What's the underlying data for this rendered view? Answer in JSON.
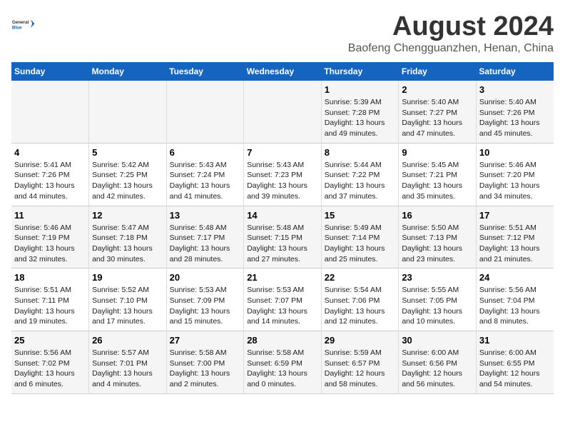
{
  "header": {
    "logo_line1": "General",
    "logo_line2": "Blue",
    "month_year": "August 2024",
    "location": "Baofeng Chengguanzhen, Henan, China"
  },
  "days_of_week": [
    "Sunday",
    "Monday",
    "Tuesday",
    "Wednesday",
    "Thursday",
    "Friday",
    "Saturday"
  ],
  "weeks": [
    [
      {
        "day": "",
        "info": ""
      },
      {
        "day": "",
        "info": ""
      },
      {
        "day": "",
        "info": ""
      },
      {
        "day": "",
        "info": ""
      },
      {
        "day": "1",
        "info": "Sunrise: 5:39 AM\nSunset: 7:28 PM\nDaylight: 13 hours\nand 49 minutes."
      },
      {
        "day": "2",
        "info": "Sunrise: 5:40 AM\nSunset: 7:27 PM\nDaylight: 13 hours\nand 47 minutes."
      },
      {
        "day": "3",
        "info": "Sunrise: 5:40 AM\nSunset: 7:26 PM\nDaylight: 13 hours\nand 45 minutes."
      }
    ],
    [
      {
        "day": "4",
        "info": "Sunrise: 5:41 AM\nSunset: 7:26 PM\nDaylight: 13 hours\nand 44 minutes."
      },
      {
        "day": "5",
        "info": "Sunrise: 5:42 AM\nSunset: 7:25 PM\nDaylight: 13 hours\nand 42 minutes."
      },
      {
        "day": "6",
        "info": "Sunrise: 5:43 AM\nSunset: 7:24 PM\nDaylight: 13 hours\nand 41 minutes."
      },
      {
        "day": "7",
        "info": "Sunrise: 5:43 AM\nSunset: 7:23 PM\nDaylight: 13 hours\nand 39 minutes."
      },
      {
        "day": "8",
        "info": "Sunrise: 5:44 AM\nSunset: 7:22 PM\nDaylight: 13 hours\nand 37 minutes."
      },
      {
        "day": "9",
        "info": "Sunrise: 5:45 AM\nSunset: 7:21 PM\nDaylight: 13 hours\nand 35 minutes."
      },
      {
        "day": "10",
        "info": "Sunrise: 5:46 AM\nSunset: 7:20 PM\nDaylight: 13 hours\nand 34 minutes."
      }
    ],
    [
      {
        "day": "11",
        "info": "Sunrise: 5:46 AM\nSunset: 7:19 PM\nDaylight: 13 hours\nand 32 minutes."
      },
      {
        "day": "12",
        "info": "Sunrise: 5:47 AM\nSunset: 7:18 PM\nDaylight: 13 hours\nand 30 minutes."
      },
      {
        "day": "13",
        "info": "Sunrise: 5:48 AM\nSunset: 7:17 PM\nDaylight: 13 hours\nand 28 minutes."
      },
      {
        "day": "14",
        "info": "Sunrise: 5:48 AM\nSunset: 7:15 PM\nDaylight: 13 hours\nand 27 minutes."
      },
      {
        "day": "15",
        "info": "Sunrise: 5:49 AM\nSunset: 7:14 PM\nDaylight: 13 hours\nand 25 minutes."
      },
      {
        "day": "16",
        "info": "Sunrise: 5:50 AM\nSunset: 7:13 PM\nDaylight: 13 hours\nand 23 minutes."
      },
      {
        "day": "17",
        "info": "Sunrise: 5:51 AM\nSunset: 7:12 PM\nDaylight: 13 hours\nand 21 minutes."
      }
    ],
    [
      {
        "day": "18",
        "info": "Sunrise: 5:51 AM\nSunset: 7:11 PM\nDaylight: 13 hours\nand 19 minutes."
      },
      {
        "day": "19",
        "info": "Sunrise: 5:52 AM\nSunset: 7:10 PM\nDaylight: 13 hours\nand 17 minutes."
      },
      {
        "day": "20",
        "info": "Sunrise: 5:53 AM\nSunset: 7:09 PM\nDaylight: 13 hours\nand 15 minutes."
      },
      {
        "day": "21",
        "info": "Sunrise: 5:53 AM\nSunset: 7:07 PM\nDaylight: 13 hours\nand 14 minutes."
      },
      {
        "day": "22",
        "info": "Sunrise: 5:54 AM\nSunset: 7:06 PM\nDaylight: 13 hours\nand 12 minutes."
      },
      {
        "day": "23",
        "info": "Sunrise: 5:55 AM\nSunset: 7:05 PM\nDaylight: 13 hours\nand 10 minutes."
      },
      {
        "day": "24",
        "info": "Sunrise: 5:56 AM\nSunset: 7:04 PM\nDaylight: 13 hours\nand 8 minutes."
      }
    ],
    [
      {
        "day": "25",
        "info": "Sunrise: 5:56 AM\nSunset: 7:02 PM\nDaylight: 13 hours\nand 6 minutes."
      },
      {
        "day": "26",
        "info": "Sunrise: 5:57 AM\nSunset: 7:01 PM\nDaylight: 13 hours\nand 4 minutes."
      },
      {
        "day": "27",
        "info": "Sunrise: 5:58 AM\nSunset: 7:00 PM\nDaylight: 13 hours\nand 2 minutes."
      },
      {
        "day": "28",
        "info": "Sunrise: 5:58 AM\nSunset: 6:59 PM\nDaylight: 13 hours\nand 0 minutes."
      },
      {
        "day": "29",
        "info": "Sunrise: 5:59 AM\nSunset: 6:57 PM\nDaylight: 12 hours\nand 58 minutes."
      },
      {
        "day": "30",
        "info": "Sunrise: 6:00 AM\nSunset: 6:56 PM\nDaylight: 12 hours\nand 56 minutes."
      },
      {
        "day": "31",
        "info": "Sunrise: 6:00 AM\nSunset: 6:55 PM\nDaylight: 12 hours\nand 54 minutes."
      }
    ]
  ]
}
